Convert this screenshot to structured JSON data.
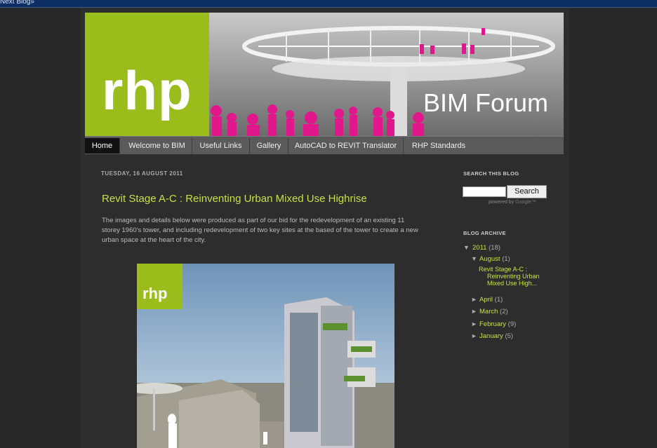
{
  "navbar": {
    "next_blog": "Next Blog»"
  },
  "header": {
    "logo_text": "rhp",
    "forum_title": "BIM Forum"
  },
  "tabs": [
    {
      "label": "Home",
      "active": true
    },
    {
      "label": "Welcome to BIM"
    },
    {
      "label": "Useful Links"
    },
    {
      "label": "Gallery"
    },
    {
      "label": "AutoCAD to REVIT Translator"
    },
    {
      "label": "RHP Standards"
    }
  ],
  "post": {
    "date": "TUESDAY, 16 AUGUST 2011",
    "title": "Revit Stage A-C : Reinventing Urban Mixed Use Highrise",
    "body": "The images and details below were produced as part of our bid for the redevelopment of an existing 11 storey 1960's tower, and including redevelopment of two key sites at the based of the tower to create a new urban space at the heart of the city.",
    "image_logo_text": "rhp"
  },
  "sidebar": {
    "search_heading": "SEARCH THIS BLOG",
    "search_button": "Search",
    "powered_by": "powered by",
    "powered_brand": "Google™",
    "archive_heading": "BLOG ARCHIVE",
    "year": {
      "label": "2011",
      "count": "(18)"
    },
    "months": [
      {
        "label": "August",
        "count": "(1)",
        "expanded": true
      },
      {
        "label": "April",
        "count": "(1)"
      },
      {
        "label": "March",
        "count": "(2)"
      },
      {
        "label": "February",
        "count": "(9)"
      },
      {
        "label": "January",
        "count": "(5)"
      }
    ],
    "archived_post_line1": "Revit Stage A-C :",
    "archived_post_line2": "Reinventing Urban",
    "archived_post_line3": "Mixed Use High..."
  },
  "icons": {
    "expanded": "▼",
    "collapsed": "►"
  },
  "colors": {
    "accent": "#c7e043",
    "logo_green": "#9bbd1c",
    "navbar": "#0c2e63",
    "background": "#272727"
  }
}
